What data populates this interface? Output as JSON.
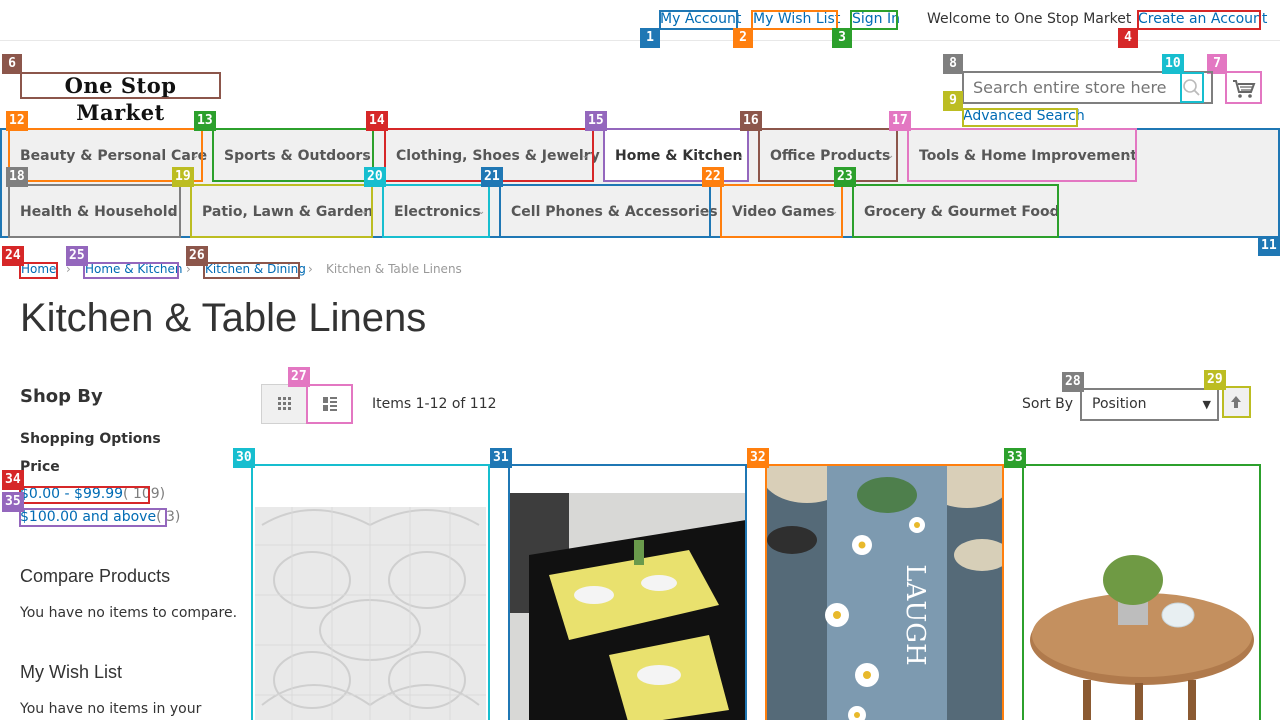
{
  "header": {
    "links": {
      "my_account": "My Account",
      "my_wish_list": "My Wish List",
      "sign_in": "Sign In",
      "create_account": "Create an Account"
    },
    "welcome": "Welcome to One Stop Market",
    "logo_text": "One Stop Market",
    "search_placeholder": "Search entire store here...",
    "advanced_search": "Advanced Search"
  },
  "nav": {
    "items": [
      "Beauty & Personal Care",
      "Sports & Outdoors",
      "Clothing, Shoes & Jewelry",
      "Home & Kitchen",
      "Office Products",
      "Tools & Home Improvement",
      "Health & Household",
      "Patio, Lawn & Garden",
      "Electronics",
      "Cell Phones & Accessories",
      "Video Games",
      "Grocery & Gourmet Food"
    ]
  },
  "breadcrumbs": [
    "Home",
    "Home & Kitchen",
    "Kitchen & Dining",
    "Kitchen & Table Linens"
  ],
  "page_title": "Kitchen & Table Linens",
  "sidebar": {
    "shop_by": "Shop By",
    "shopping_options": "Shopping Options",
    "price_label": "Price",
    "price_options": [
      {
        "label": "$0.00 - $99.99",
        "count": "( 109)"
      },
      {
        "label": "$100.00 and above",
        "count": "( 3)"
      }
    ],
    "compare_title": "Compare Products",
    "compare_text": "You have no items to compare.",
    "wishlist_title": "My Wish List",
    "wishlist_text": "You have no items in your"
  },
  "toolbar": {
    "items_count": "Items 1-12 of 112",
    "sort_label": "Sort By",
    "sort_value": "Position"
  },
  "overlay_labels": [
    "1",
    "2",
    "3",
    "4",
    "6",
    "7",
    "8",
    "9",
    "10",
    "11",
    "12",
    "13",
    "14",
    "15",
    "16",
    "17",
    "18",
    "19",
    "20",
    "21",
    "22",
    "23",
    "24",
    "25",
    "26",
    "27",
    "28",
    "29",
    "30",
    "31",
    "32",
    "33",
    "34",
    "35"
  ],
  "colors": {
    "link": "#006bb4",
    "nav_bg": "#f0f0f0"
  }
}
